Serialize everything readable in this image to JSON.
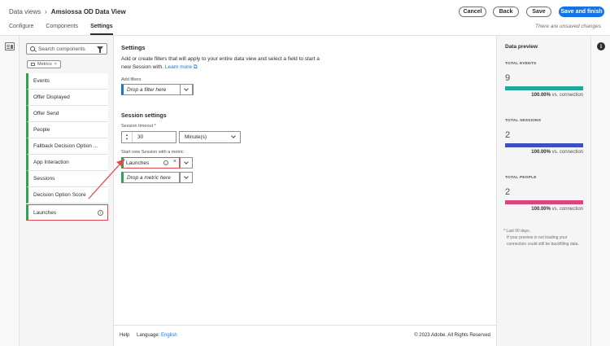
{
  "header": {
    "breadcrumb_parent": "Data views",
    "breadcrumb_sep": "›",
    "breadcrumb_current": "Amsiossa OD Data View",
    "tabs": [
      {
        "label": "Configure"
      },
      {
        "label": "Components"
      },
      {
        "label": "Settings"
      }
    ],
    "active_tab": "Settings",
    "buttons": {
      "cancel": "Cancel",
      "back": "Back",
      "save": "Save",
      "save_finish": "Save and finish"
    },
    "unsaved_text": "There are unsaved changes"
  },
  "components": {
    "search_placeholder": "Search components",
    "filter_chip": "Metrics",
    "filter_chip_close": "×",
    "items": [
      {
        "label": "Events"
      },
      {
        "label": "Offer Displayed"
      },
      {
        "label": "Offer Send"
      },
      {
        "label": "People"
      },
      {
        "label": "Fallback Decision Option ..."
      },
      {
        "label": "App Interaction"
      },
      {
        "label": "Sessions"
      },
      {
        "label": "Decision Option Score"
      },
      {
        "label": "Launches"
      }
    ],
    "info_glyph": "i"
  },
  "settings": {
    "heading": "Settings",
    "description": "Add or create filters that will apply to your entire data view and select a field to start a new Session with.",
    "learn_more": "Learn more",
    "add_filters_label": "Add filters",
    "filter_placeholder": "Drop a filter here",
    "session_heading": "Session settings",
    "timeout_label": "Session timeout",
    "timeout_required": "*",
    "timeout_value": "30",
    "timeout_unit": "Minute(s)",
    "start_label": "Start new Session with a metric",
    "metric_value": "Launches",
    "metric_placeholder": "Drop a metric here"
  },
  "footer": {
    "help": "Help",
    "language_label": "Language:",
    "language_value": "English",
    "copyright": "© 2023 Adobe. All Rights Reserved"
  },
  "preview": {
    "title": "Data preview",
    "stats": [
      {
        "label": "TOTAL EVENTS",
        "value": "9",
        "pct": "100.00%",
        "suffix": "vs. connection",
        "color": "#1fa89b"
      },
      {
        "label": "TOTAL SESSIONS",
        "value": "2",
        "pct": "100.00%",
        "suffix": "vs. connection",
        "color": "#3f4fbf"
      },
      {
        "label": "TOTAL PEOPLE",
        "value": "2",
        "pct": "100.00%",
        "suffix": "vs. connection",
        "color": "#d9457f"
      }
    ],
    "note_1": "* Last 90 days.",
    "note_2": "If your preview is not loading your connection could still be backfilling data."
  },
  "colors": {
    "accent": "#1473e6",
    "metric_green": "#2da44e",
    "highlight_red": "#e34850"
  }
}
